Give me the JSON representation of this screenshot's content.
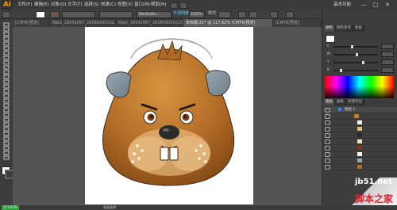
{
  "app": {
    "logo": "Ai"
  },
  "menubar": {
    "items": [
      "文件(F)",
      "编辑(E)",
      "对象(O)",
      "文字(T)",
      "选择(S)",
      "效果(C)",
      "视图(V)",
      "窗口(W)",
      "帮助(H)"
    ],
    "workspace_label": "基本功能",
    "win_minimize": "—",
    "win_maximize": "□",
    "win_close": "✕"
  },
  "controlbar": {
    "brush_value": "Barbodo...",
    "style_label": "不透明度",
    "opacity_value": "100%",
    "style2_label": "样式"
  },
  "tabs": [
    {
      "label": "[CMYK/预览]",
      "active": false
    },
    {
      "label": "Nipic_29542087_20180305102324767000.ai*",
      "active": false
    },
    {
      "label": "Nipic_29542087_20180305102318640000.ai*",
      "active": false
    },
    {
      "label": "未标题-21* @ 117.62% (CMYK/预览)",
      "active": true
    },
    {
      "label": "[CMYK/预览]",
      "active": false
    }
  ],
  "right_panel": {
    "top_tabs": [
      "颜色",
      "颜色参考",
      "色板"
    ],
    "color_sliders": [
      "C",
      "M",
      "Y",
      "K"
    ],
    "layer_tabs": [
      "图层",
      "画板",
      "资源导出"
    ],
    "layer_name": "图层 1"
  },
  "statusbar": {
    "zoom": "117.62%",
    "tool": "直接选择"
  },
  "watermark": {
    "site": "jb51.net",
    "name": "脚本之家"
  },
  "colors": {
    "ui_dark": "#3a3a3a",
    "canvas": "#535353",
    "face_top": "#c47a2c",
    "face_bottom": "#8a4d16",
    "headphone": "#7d8d9a",
    "ai_orange": "#ff9a00"
  }
}
